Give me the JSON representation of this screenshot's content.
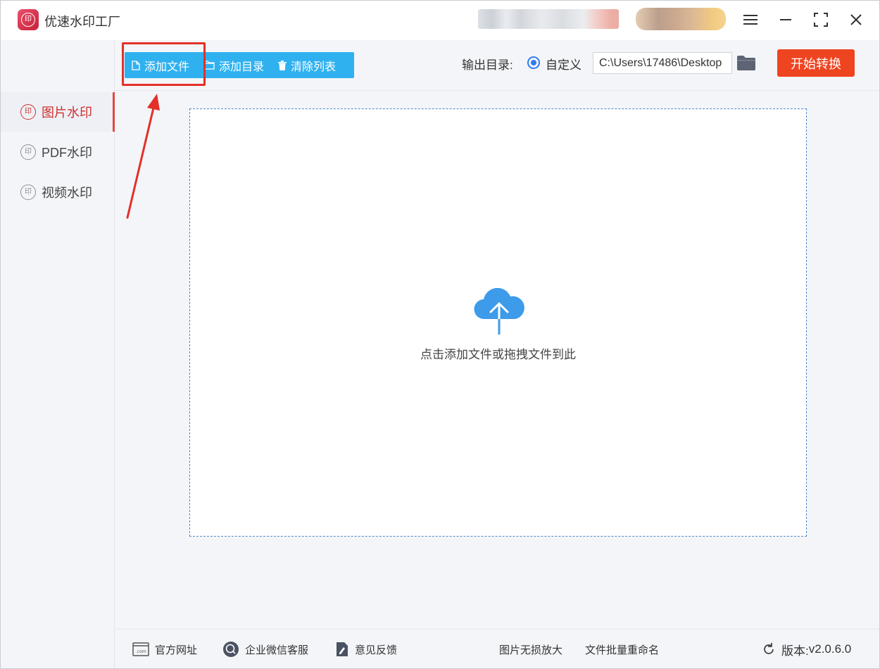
{
  "app": {
    "title": "优速水印工厂"
  },
  "sidebar": {
    "items": [
      {
        "label": "图片水印",
        "active": true
      },
      {
        "label": "PDF水印",
        "active": false
      },
      {
        "label": "视频水印",
        "active": false
      }
    ]
  },
  "toolbar": {
    "add_file": "添加文件",
    "add_dir": "添加目录",
    "clear_list": "清除列表",
    "output_label": "输出目录:",
    "custom_label": "自定义",
    "output_path": "C:\\Users\\17486\\Desktop",
    "start_label": "开始转换"
  },
  "dropzone": {
    "hint": "点击添加文件或拖拽文件到此"
  },
  "footer": {
    "website": "官方网址",
    "wechat_service": "企业微信客服",
    "feedback": "意见反馈",
    "lossless_enlarge": "图片无损放大",
    "batch_rename": "文件批量重命名",
    "version_label": "版本:",
    "version": "v2.0.6.0"
  },
  "colors": {
    "accent_blue": "#2fb1f0",
    "start_orange": "#ef4420",
    "annotation_red": "#e3302a",
    "active_red": "#d0312d"
  },
  "icons": [
    "app-logo",
    "menu-icon",
    "minimize-icon",
    "fullscreen-icon",
    "close-icon",
    "file-icon",
    "folder-icon",
    "trash-icon",
    "cloud-upload-icon",
    "website-icon",
    "wechat-icon",
    "feedback-icon",
    "refresh-icon"
  ]
}
